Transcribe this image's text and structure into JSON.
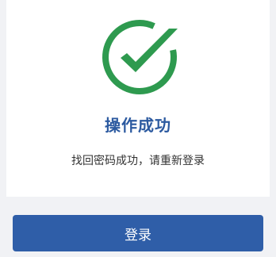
{
  "result": {
    "title": "操作成功",
    "message": "找回密码成功，请重新登录",
    "icon": "check-circle-icon",
    "icon_color": "#2e9a4f"
  },
  "actions": {
    "login_label": "登录",
    "button_color": "#2f5ea8"
  },
  "colors": {
    "title": "#2c5aa0",
    "background": "#f1f2f5",
    "card": "#ffffff"
  }
}
